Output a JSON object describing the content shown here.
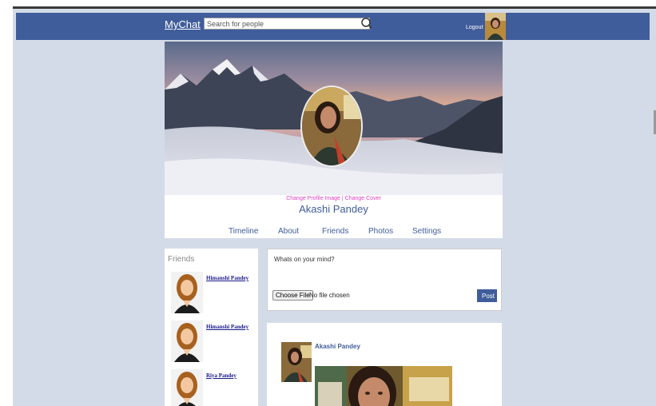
{
  "header": {
    "brand": "MyChat",
    "search_placeholder": "Search for people",
    "logout_label": "Logout"
  },
  "profile": {
    "change_profile_image": "Change Profile Image",
    "separator": "|",
    "change_cover": "Change Cover",
    "name": "Akashi Pandey",
    "tabs": [
      "Timeline",
      "About",
      "Friends",
      "Photos",
      "Settings"
    ]
  },
  "friends": {
    "title": "Friends",
    "items": [
      {
        "name": "Himanshi Pandey"
      },
      {
        "name": "Himanshi Pandey"
      },
      {
        "name": "Riya Pandey"
      }
    ]
  },
  "composer": {
    "placeholder": "Whats on your mind?",
    "choose_file_label": "Choose File",
    "no_file_text": "No file chosen",
    "post_label": "Post"
  },
  "feed": {
    "post_author": "Akashi Pandey"
  },
  "colors": {
    "header_bg": "#405d9b",
    "page_bg": "#d4dbe8",
    "link_pink": "#e040c0"
  }
}
